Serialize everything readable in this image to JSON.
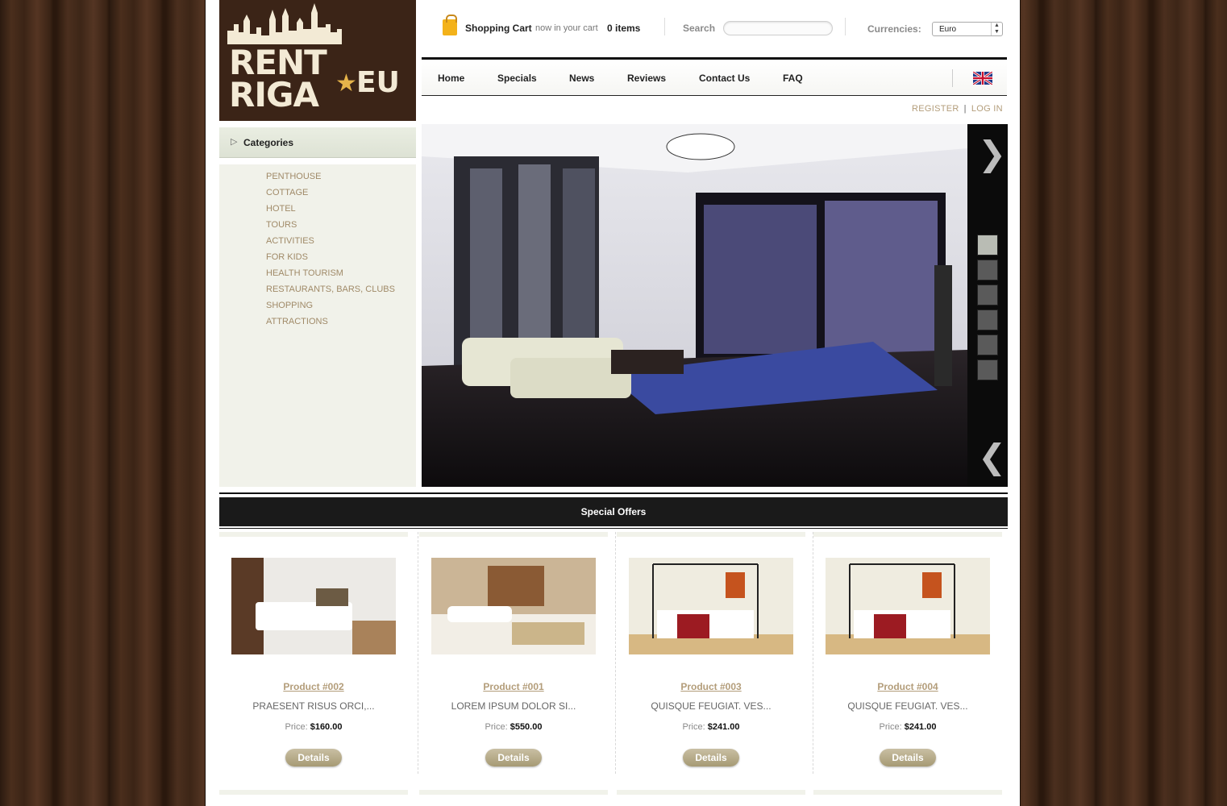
{
  "logo": {
    "line1": "RENT",
    "line2": "RIGA",
    "suffix": "EU"
  },
  "cart": {
    "title": "Shopping Cart",
    "note": "now in your cart",
    "count": "0 items"
  },
  "search": {
    "label": "Search",
    "value": ""
  },
  "currencies": {
    "label": "Currencies:",
    "selected": "Euro"
  },
  "nav": {
    "items": [
      "Home",
      "Specials",
      "News",
      "Reviews",
      "Contact Us",
      "FAQ"
    ]
  },
  "auth": {
    "register": "REGISTER",
    "login": "LOG IN"
  },
  "sidebar": {
    "title": "Categories",
    "items": [
      "PENTHOUSE",
      "COTTAGE",
      "HOTEL",
      "TOURS",
      "ACTIVITIES",
      "FOR KIDS",
      "HEALTH TOURISM",
      "RESTAURANTS, BARS, CLUBS",
      "SHOPPING",
      "ATTRACTIONS"
    ]
  },
  "slider": {
    "thumbs": 6,
    "active_thumb": 0
  },
  "special_offers": {
    "title": "Special Offers",
    "products": [
      {
        "name": "Product #002",
        "desc": "PRAESENT RISUS ORCI,...",
        "price_label": "Price:",
        "price": "$160.00",
        "button": "Details"
      },
      {
        "name": "Product #001",
        "desc": "LOREM IPSUM DOLOR SI...",
        "price_label": "Price:",
        "price": "$550.00",
        "button": "Details"
      },
      {
        "name": "Product #003",
        "desc": "QUISQUE FEUGIAT. VES...",
        "price_label": "Price:",
        "price": "$241.00",
        "button": "Details"
      },
      {
        "name": "Product #004",
        "desc": "QUISQUE FEUGIAT. VES...",
        "price_label": "Price:",
        "price": "$241.00",
        "button": "Details"
      }
    ]
  },
  "colors": {
    "wood": "#3a2417",
    "accent": "#b39d7a",
    "dark_bar": "#1a1a1a",
    "sidebar_bg": "#f1f2ea"
  }
}
